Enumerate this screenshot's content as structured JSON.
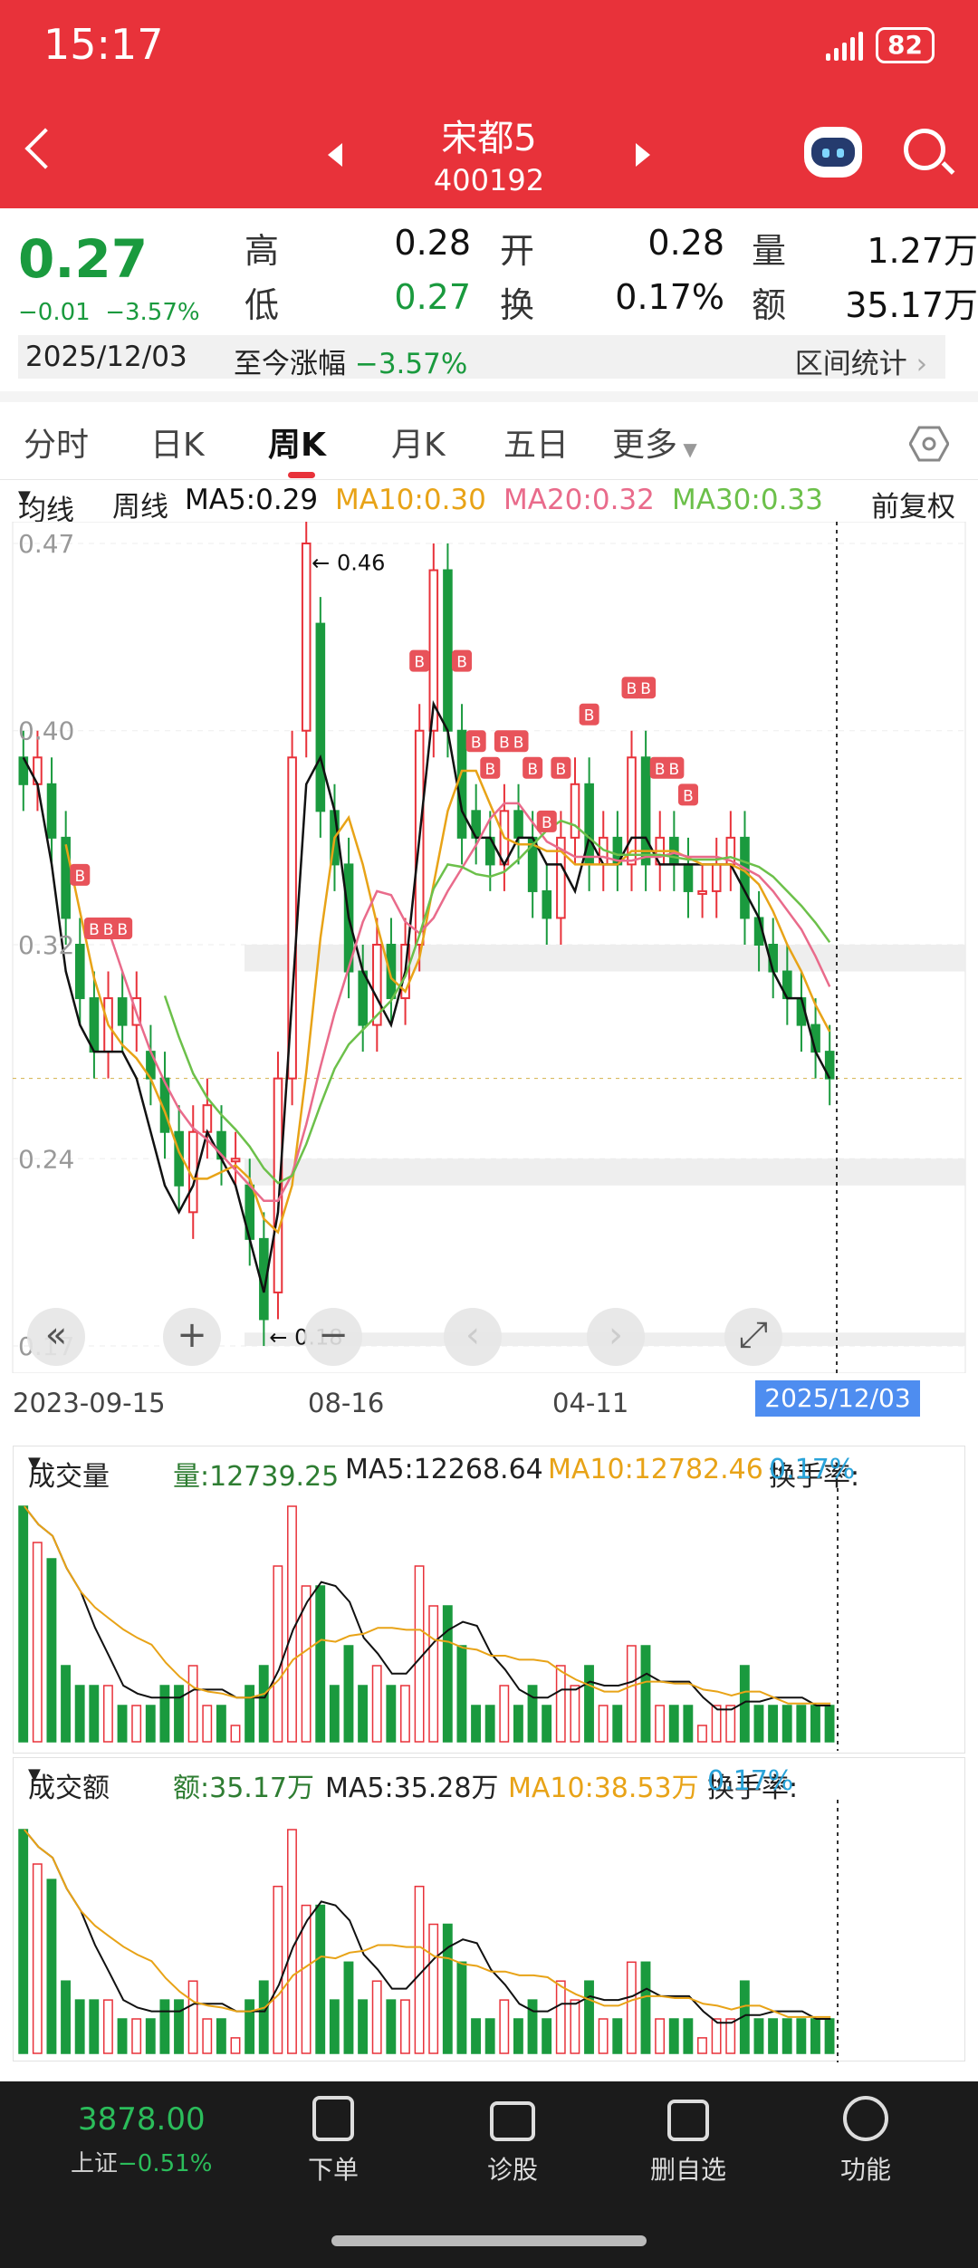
{
  "status": {
    "time": "15:17",
    "battery": "82"
  },
  "header": {
    "name": "宋都5",
    "code": "400192"
  },
  "quote": {
    "price": "0.27",
    "change": "−0.01",
    "change_pct": "−3.57%",
    "high_label": "高",
    "high": "0.28",
    "low_label": "低",
    "low": "0.27",
    "open_label": "开",
    "open": "0.28",
    "turnover_label": "换",
    "turnover": "0.17%",
    "volume_label": "量",
    "volume": "1.27万",
    "amount_label": "额",
    "amount": "35.17万",
    "date": "2025/12/03",
    "range_label": "至今涨幅",
    "range_value": "−3.57%",
    "stat_label": "区间统计"
  },
  "tabs": [
    "分时",
    "日K",
    "周K",
    "月K",
    "五日",
    "更多"
  ],
  "active_tab": "周K",
  "ma": {
    "mode": "均线",
    "period": "周线",
    "ma5": "MA5:0.29",
    "ma10": "MA10:0.30",
    "ma20": "MA20:0.32",
    "ma30": "MA30:0.33",
    "adjust": "前复权"
  },
  "colors": {
    "up": "#e8323a",
    "down": "#1a9a3e",
    "ma5": "#111111",
    "ma10": "#e8a317",
    "ma20": "#e96b8b",
    "ma30": "#6cc04a"
  },
  "chart_data": {
    "type": "candlestick",
    "y_ticks": [
      "0.47",
      "0.40",
      "0.32",
      "0.24",
      "0.17"
    ],
    "ylim": [
      0.17,
      0.47
    ],
    "x_ticks": [
      "2023-09-15",
      "08-16",
      "04-11",
      "12-03"
    ],
    "selected_date": "2025/12/03",
    "annotations": [
      {
        "label": "← 0.46",
        "value": 0.46
      },
      {
        "label": "← 0.18",
        "value": 0.18
      }
    ],
    "marker_label": "B",
    "ma5_series": [
      0.39,
      0.38,
      0.35,
      0.31,
      0.29,
      0.28,
      0.28,
      0.28,
      0.27,
      0.25,
      0.23,
      0.22,
      0.23,
      0.25,
      0.24,
      0.23,
      0.21,
      0.19,
      0.22,
      0.3,
      0.38,
      0.39,
      0.37,
      0.33,
      0.31,
      0.3,
      0.29,
      0.31,
      0.36,
      0.41,
      0.4,
      0.37,
      0.36,
      0.36,
      0.35,
      0.36,
      0.36,
      0.35,
      0.35,
      0.34,
      0.36,
      0.35,
      0.35,
      0.36,
      0.36,
      0.35,
      0.35,
      0.35,
      0.35,
      0.35,
      0.35,
      0.34,
      0.33,
      0.31,
      0.3,
      0.3,
      0.28,
      0.27
    ],
    "candles": [
      [
        0.39,
        0.38
      ],
      [
        0.38,
        0.39
      ],
      [
        0.38,
        0.36
      ],
      [
        0.36,
        0.33
      ],
      [
        0.32,
        0.3
      ],
      [
        0.3,
        0.28
      ],
      [
        0.28,
        0.3
      ],
      [
        0.3,
        0.29
      ],
      [
        0.29,
        0.3
      ],
      [
        0.28,
        0.27
      ],
      [
        0.27,
        0.25
      ],
      [
        0.25,
        0.23
      ],
      [
        0.22,
        0.25
      ],
      [
        0.25,
        0.26
      ],
      [
        0.25,
        0.24
      ],
      [
        0.24,
        0.24
      ],
      [
        0.23,
        0.21
      ],
      [
        0.21,
        0.18
      ],
      [
        0.19,
        0.27
      ],
      [
        0.27,
        0.39
      ],
      [
        0.4,
        0.47
      ],
      [
        0.44,
        0.37
      ],
      [
        0.37,
        0.35
      ],
      [
        0.35,
        0.31
      ],
      [
        0.31,
        0.29
      ],
      [
        0.29,
        0.32
      ],
      [
        0.32,
        0.3
      ],
      [
        0.3,
        0.32
      ],
      [
        0.32,
        0.4
      ],
      [
        0.4,
        0.46
      ],
      [
        0.46,
        0.4
      ],
      [
        0.4,
        0.36
      ],
      [
        0.37,
        0.36
      ],
      [
        0.36,
        0.35
      ],
      [
        0.35,
        0.37
      ],
      [
        0.37,
        0.36
      ],
      [
        0.36,
        0.34
      ],
      [
        0.34,
        0.33
      ],
      [
        0.33,
        0.36
      ],
      [
        0.36,
        0.38
      ],
      [
        0.38,
        0.35
      ],
      [
        0.35,
        0.36
      ],
      [
        0.36,
        0.35
      ],
      [
        0.35,
        0.39
      ],
      [
        0.39,
        0.35
      ],
      [
        0.35,
        0.36
      ],
      [
        0.36,
        0.35
      ],
      [
        0.35,
        0.34
      ],
      [
        0.34,
        0.34
      ],
      [
        0.34,
        0.35
      ],
      [
        0.35,
        0.36
      ],
      [
        0.36,
        0.33
      ],
      [
        0.33,
        0.32
      ],
      [
        0.32,
        0.31
      ],
      [
        0.31,
        0.3
      ],
      [
        0.3,
        0.29
      ],
      [
        0.29,
        0.28
      ],
      [
        0.28,
        0.27
      ]
    ]
  },
  "volume_panel": {
    "label": "成交量",
    "value": "量:12739.25",
    "ma5": "MA5:12268.64",
    "ma10": "MA10:12782.46",
    "turnover_label": "换手率:",
    "turnover_value": "0.17%"
  },
  "amount_panel": {
    "label": "成交额",
    "value": "额:35.17万",
    "ma5": "MA5:35.28万",
    "ma10": "MA10:38.53万",
    "turnover_label": "换手率:",
    "turnover_value": "0.17%"
  },
  "bottom": {
    "index_value": "3878.00",
    "index_name": "上证",
    "index_change": "−0.51%",
    "tabs": [
      "下单",
      "诊股",
      "删自选",
      "功能"
    ]
  }
}
